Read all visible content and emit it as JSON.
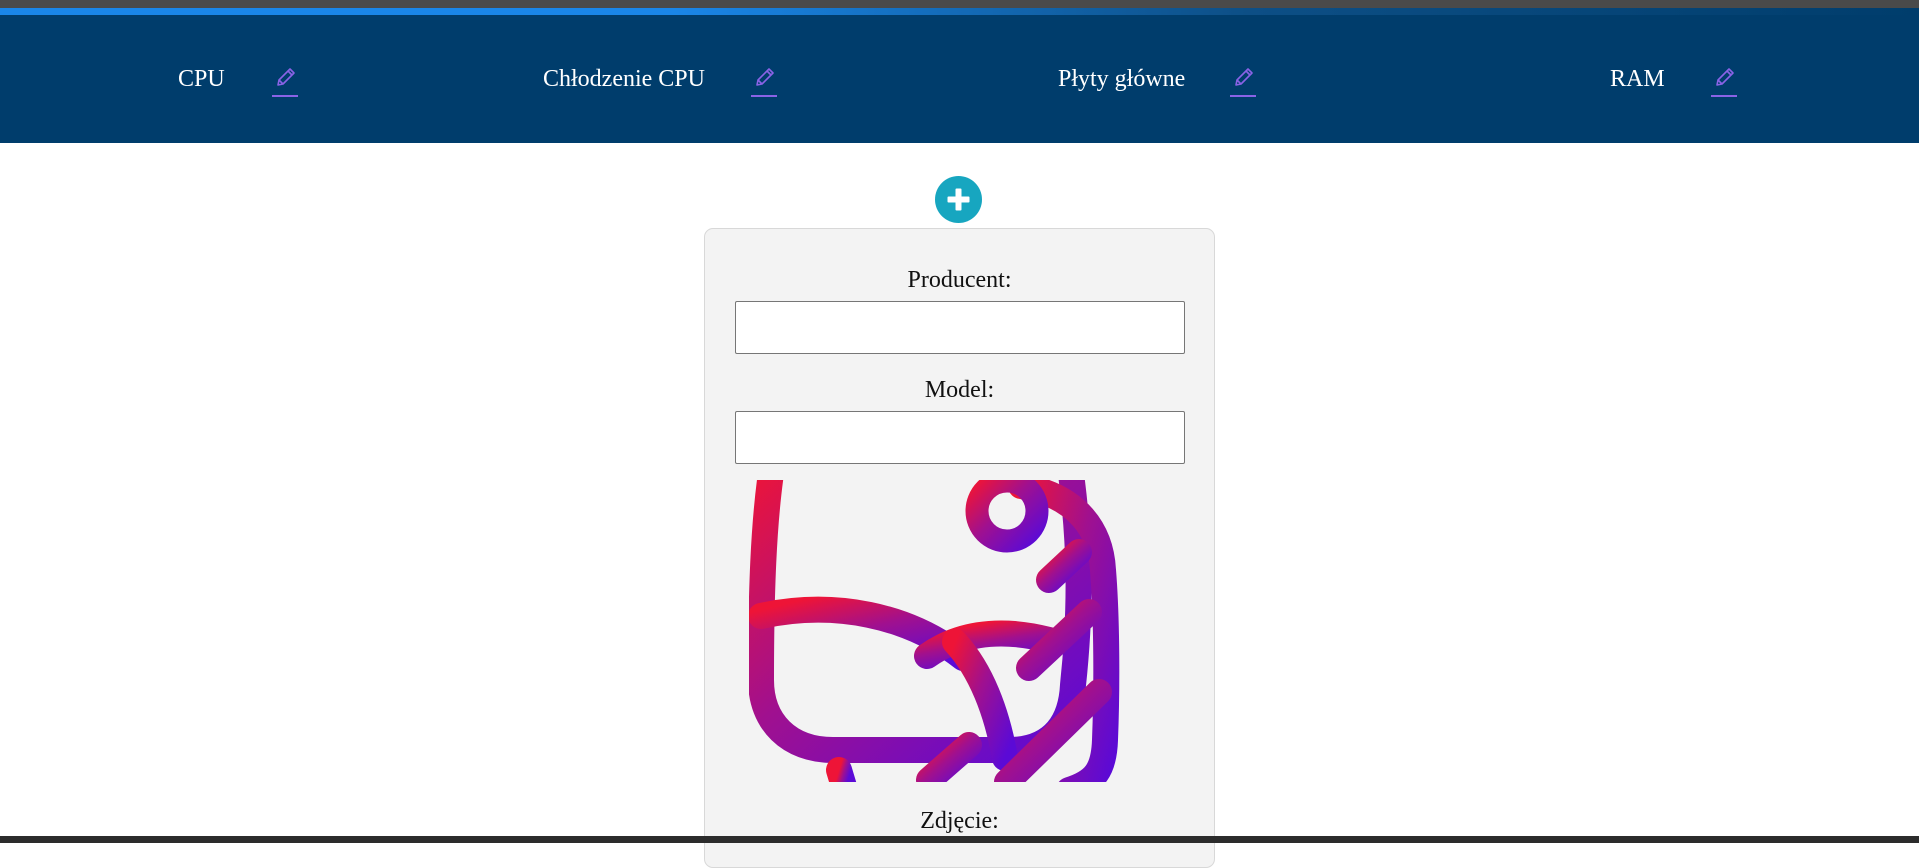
{
  "navbar": {
    "items": [
      {
        "label": "CPU"
      },
      {
        "label": "Chłodzenie CPU"
      },
      {
        "label": "Płyty główne"
      },
      {
        "label": "RAM"
      }
    ]
  },
  "form": {
    "producer_label": "Producent:",
    "producer_value": "",
    "model_label": "Model:",
    "model_value": "",
    "photo_label": "Zdjęcie:"
  },
  "icons": {
    "edit": "pencil-icon",
    "add": "plus-icon",
    "preview": "image-placeholder-icon"
  },
  "colors": {
    "navbar_bg": "#003d6c",
    "accent_blue": "#1a86e8",
    "add_button": "#17a6c0",
    "edit_icon": "#8a63e6",
    "preview_gradient_start": "#ee1437",
    "preview_gradient_end": "#5b0ad6"
  }
}
